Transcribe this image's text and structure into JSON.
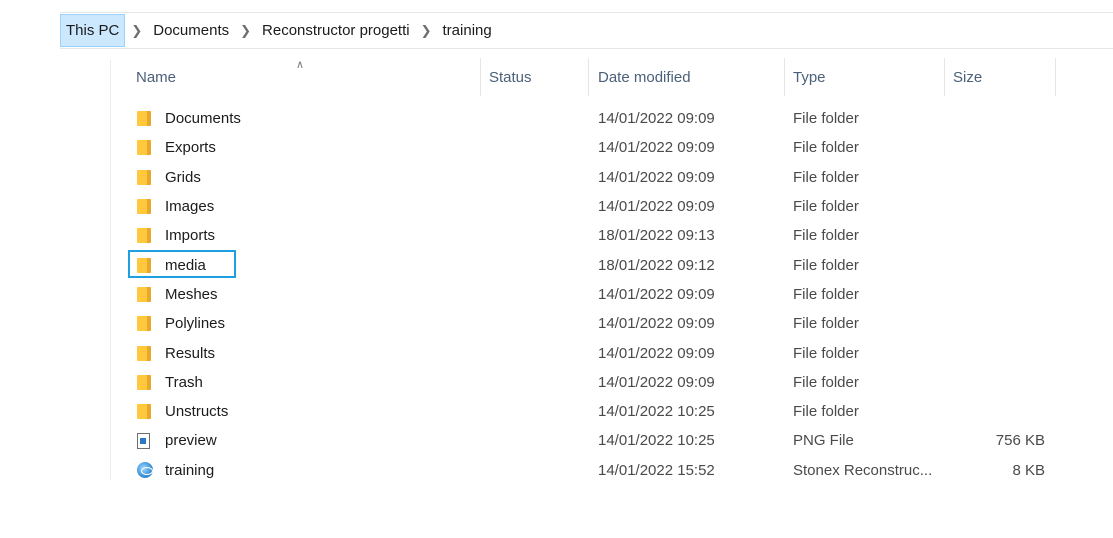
{
  "breadcrumb": [
    "This PC",
    "Documents",
    "Reconstructor progetti",
    "training"
  ],
  "columns": {
    "name": "Name",
    "status": "Status",
    "date": "Date modified",
    "type": "Type",
    "size": "Size"
  },
  "files": [
    {
      "name": "Documents",
      "date": "14/01/2022 09:09",
      "type": "File folder",
      "size": "",
      "icon": "folder-icon"
    },
    {
      "name": "Exports",
      "date": "14/01/2022 09:09",
      "type": "File folder",
      "size": "",
      "icon": "folder-icon"
    },
    {
      "name": "Grids",
      "date": "14/01/2022 09:09",
      "type": "File folder",
      "size": "",
      "icon": "folder-icon"
    },
    {
      "name": "Images",
      "date": "14/01/2022 09:09",
      "type": "File folder",
      "size": "",
      "icon": "folder-icon"
    },
    {
      "name": "Imports",
      "date": "18/01/2022 09:13",
      "type": "File folder",
      "size": "",
      "icon": "folder-icon"
    },
    {
      "name": "media",
      "date": "18/01/2022 09:12",
      "type": "File folder",
      "size": "",
      "icon": "folder-icon",
      "highlighted": true
    },
    {
      "name": "Meshes",
      "date": "14/01/2022 09:09",
      "type": "File folder",
      "size": "",
      "icon": "folder-icon"
    },
    {
      "name": "Polylines",
      "date": "14/01/2022 09:09",
      "type": "File folder",
      "size": "",
      "icon": "folder-icon"
    },
    {
      "name": "Results",
      "date": "14/01/2022 09:09",
      "type": "File folder",
      "size": "",
      "icon": "folder-icon"
    },
    {
      "name": "Trash",
      "date": "14/01/2022 09:09",
      "type": "File folder",
      "size": "",
      "icon": "folder-icon"
    },
    {
      "name": "Unstructs",
      "date": "14/01/2022 10:25",
      "type": "File folder",
      "size": "",
      "icon": "folder-icon"
    },
    {
      "name": "preview",
      "date": "14/01/2022 10:25",
      "type": "PNG File",
      "size": "756 KB",
      "icon": "image-file-icon"
    },
    {
      "name": "training",
      "date": "14/01/2022 15:52",
      "type": "Stonex Reconstruc...",
      "size": "8 KB",
      "icon": "app-file-icon"
    }
  ],
  "colors": {
    "highlight": "#1ea0e0",
    "folder": "#ffc83d",
    "breadcrumb_selected": "#cce8ff"
  }
}
